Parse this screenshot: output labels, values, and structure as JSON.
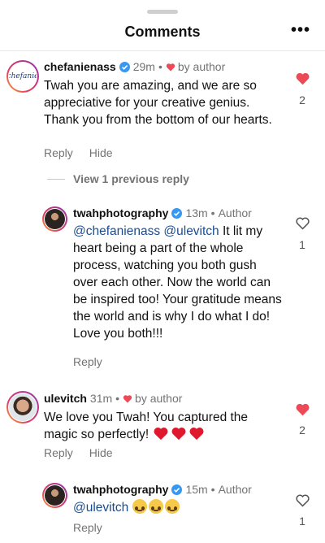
{
  "header": {
    "title": "Comments",
    "more_label": "•••"
  },
  "comments": [
    {
      "username": "chefanienass",
      "time": "29m",
      "by_label": "by author",
      "text": "Twah you are amazing, and we are so appreciative for your creative genius. Thank you from the bottom of our hearts.",
      "reply_label": "Reply",
      "hide_label": "Hide",
      "like_count": "2",
      "avatar_text": "chefanie"
    },
    {
      "username": "twahphotography",
      "time": "13m",
      "by_label": "Author",
      "mentions": [
        "@chefanienass",
        "@ulevitch"
      ],
      "text": "It lit my heart being a part of the whole process, watching you both gush over each other. Now the world can be inspired too! Your gratitude means the world and is why I do what I do! Love you both!!!",
      "reply_label": "Reply",
      "like_count": "1"
    },
    {
      "username": "ulevitch",
      "time": "31m",
      "by_label": "by author",
      "text": "We love you Twah! You captured the magic so perfectly!",
      "reply_label": "Reply",
      "hide_label": "Hide",
      "like_count": "2"
    },
    {
      "username": "twahphotography",
      "time": "15m",
      "by_label": "Author",
      "mention": "@ulevitch",
      "reply_label": "Reply",
      "like_count": "1"
    }
  ],
  "view_previous_label": "View 1 previous reply",
  "separator": "•",
  "colors": {
    "like_red": "#ed4956",
    "mention_blue": "#1a4c92",
    "verified_blue": "#3897f0"
  }
}
